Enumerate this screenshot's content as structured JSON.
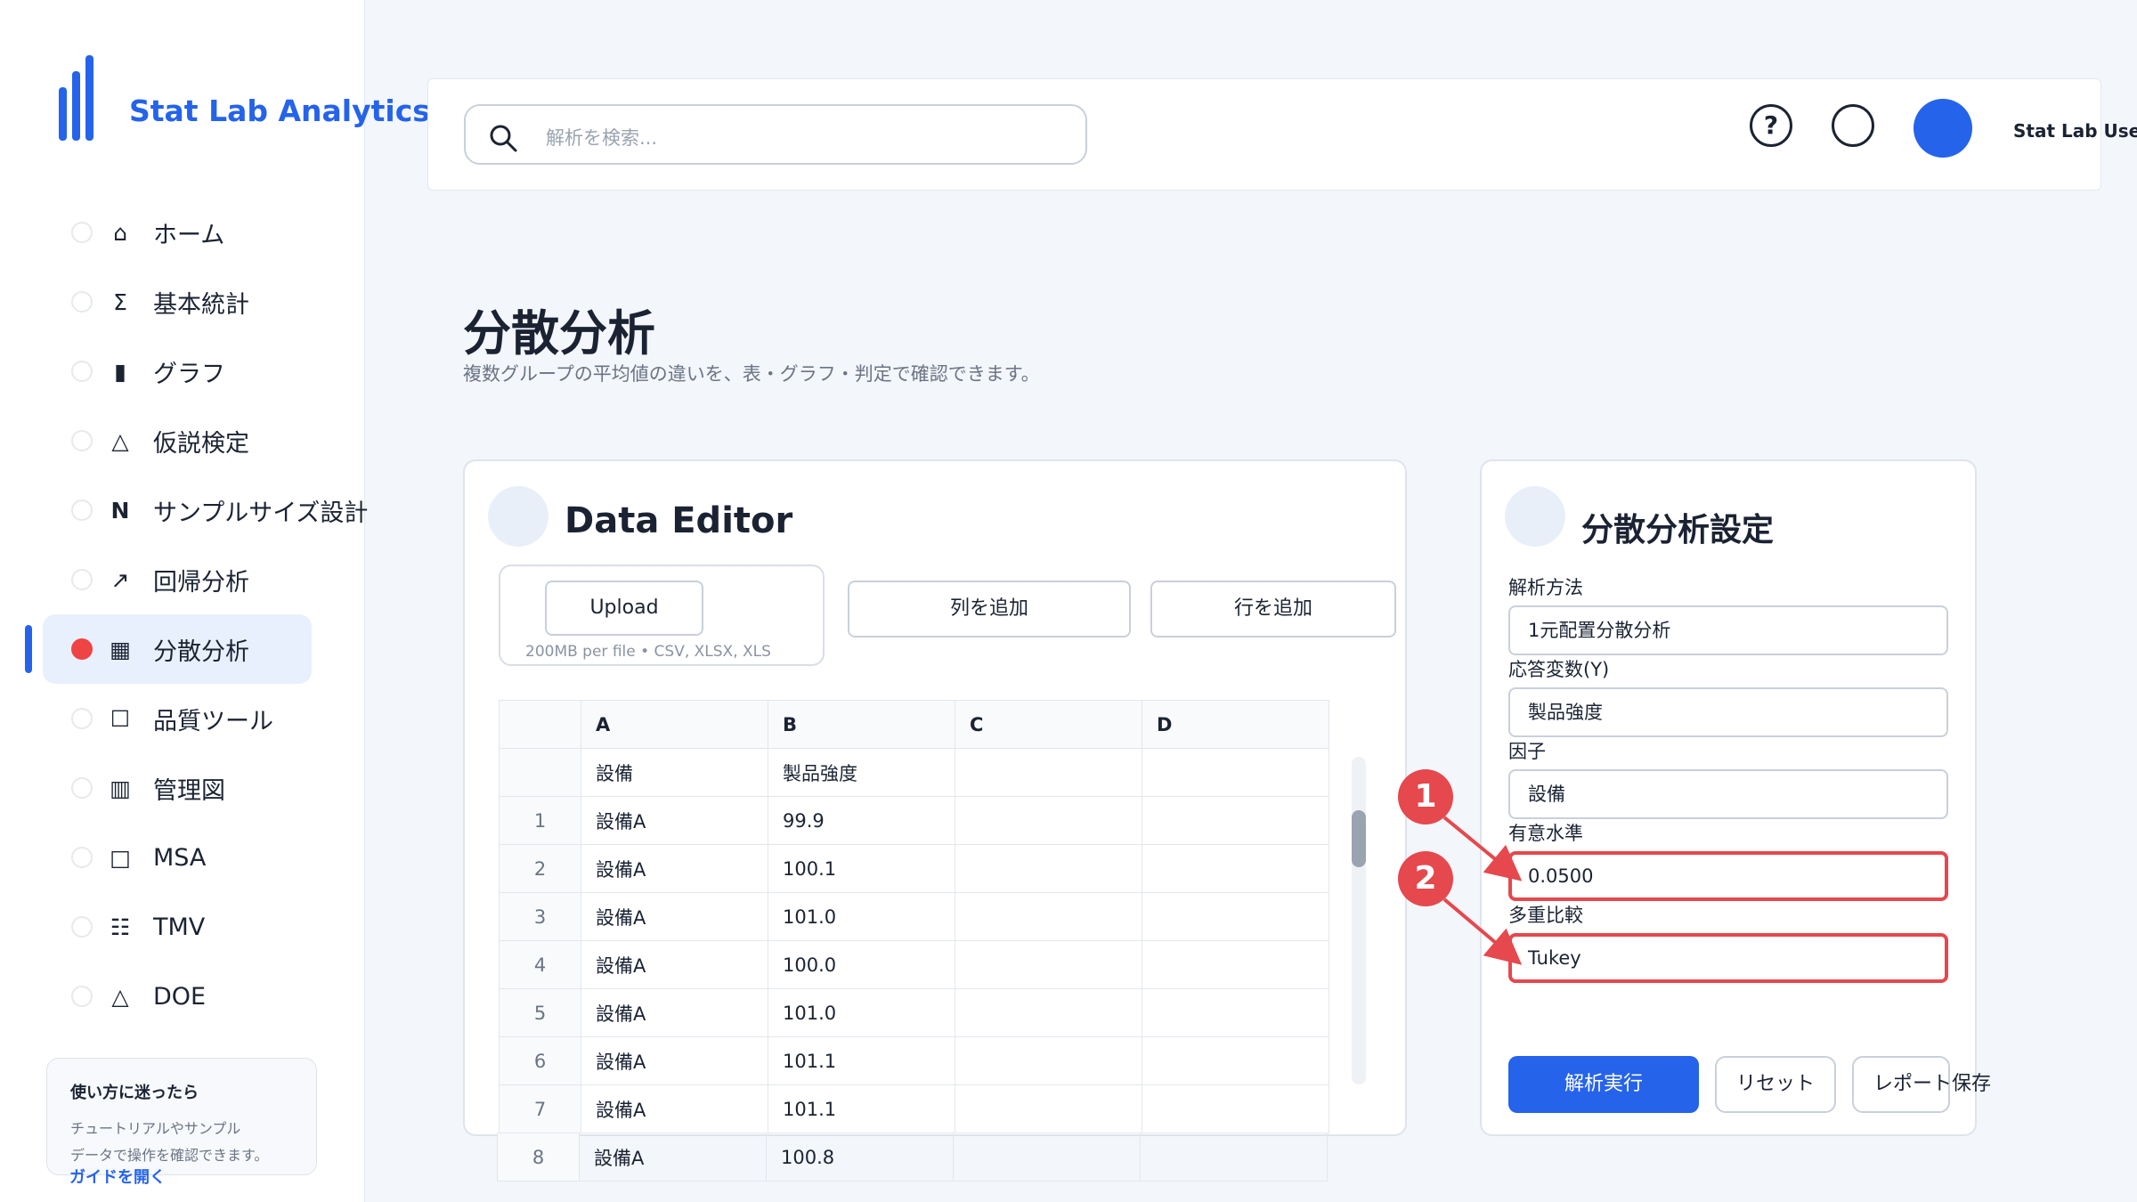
{
  "app": {
    "brand": "Stat Lab Analytics"
  },
  "sidebar": {
    "items": [
      {
        "icon": "⌂",
        "icon_name": "home-icon",
        "label": "ホーム"
      },
      {
        "icon": "Σ",
        "icon_name": "sigma-icon",
        "label": "基本統計"
      },
      {
        "icon": "▮",
        "icon_name": "bar-icon",
        "label": "グラフ"
      },
      {
        "icon": "△",
        "icon_name": "triangle-icon",
        "label": "仮説検定"
      },
      {
        "icon": "N",
        "icon_name": "n-icon",
        "label": "サンプルサイズ設計"
      },
      {
        "icon": "↗",
        "icon_name": "trend-icon",
        "label": "回帰分析"
      },
      {
        "icon": "▦",
        "icon_name": "grid-icon",
        "label": "分散分析"
      },
      {
        "icon": "☐",
        "icon_name": "square-icon",
        "label": "品質ツール"
      },
      {
        "icon": "▥",
        "icon_name": "chart-icon",
        "label": "管理図"
      },
      {
        "icon": "□",
        "icon_name": "square-outline-icon",
        "label": "MSA"
      },
      {
        "icon": "☷",
        "icon_name": "list-icon",
        "label": "TMV"
      },
      {
        "icon": "△",
        "icon_name": "triangle-icon",
        "label": "DOE"
      }
    ],
    "active_index": 6,
    "help": {
      "title": "使い方に迷ったら",
      "text_line1": "チュートリアルやサンプル",
      "text_line2": "データで操作を確認できます。",
      "link": "ガイドを開く"
    }
  },
  "header": {
    "search_placeholder": "解析を検索...",
    "help_glyph": "?",
    "user_name": "Stat Lab User"
  },
  "page": {
    "title": "分散分析",
    "subtitle": "複数グループの平均値の違いを、表・グラフ・判定で確認できます。"
  },
  "data_editor": {
    "title": "Data Editor",
    "upload_label": "Upload",
    "upload_note": "200MB per file • CSV, XLSX, XLS",
    "add_column": "列を追加",
    "add_row": "行を追加",
    "columns": [
      "A",
      "B",
      "C",
      "D"
    ],
    "header_row": [
      "設備",
      "製品強度"
    ],
    "rows": [
      {
        "n": "1",
        "a": "設備A",
        "b": "99.9"
      },
      {
        "n": "2",
        "a": "設備A",
        "b": "100.1"
      },
      {
        "n": "3",
        "a": "設備A",
        "b": "101.0"
      },
      {
        "n": "4",
        "a": "設備A",
        "b": "100.0"
      },
      {
        "n": "5",
        "a": "設備A",
        "b": "101.0"
      },
      {
        "n": "6",
        "a": "設備A",
        "b": "101.1"
      },
      {
        "n": "7",
        "a": "設備A",
        "b": "101.1"
      },
      {
        "n": "8",
        "a": "設備A",
        "b": "100.8"
      }
    ]
  },
  "settings": {
    "title": "分散分析設定",
    "method_label": "解析方法",
    "method_value": "1元配置分散分析",
    "response_label": "応答変数(Y)",
    "response_value": "製品強度",
    "factor_label": "因子",
    "factor_value": "設備",
    "alpha_label": "有意水準",
    "alpha_value": "0.0500",
    "multi_label": "多重比較",
    "multi_value": "Tukey",
    "run": "解析実行",
    "reset": "リセット",
    "report": "レポート保存"
  },
  "annotations": {
    "badge1": "1",
    "badge2": "2",
    "color": "#e5484d"
  },
  "colors": {
    "accent": "#2563eb",
    "highlight": "#e5484d"
  }
}
